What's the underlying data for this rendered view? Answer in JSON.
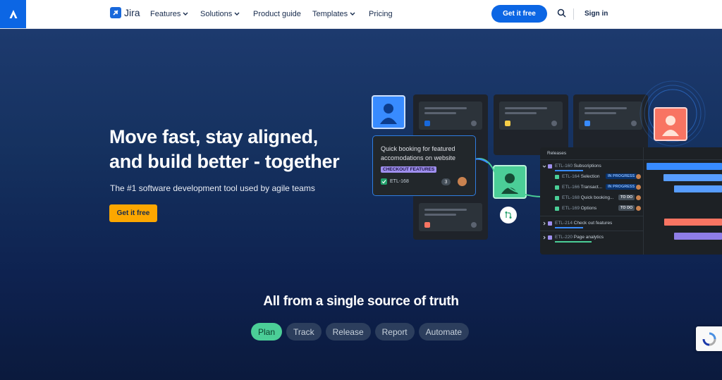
{
  "nav": {
    "brand": "Jira",
    "links": [
      "Features",
      "Solutions",
      "Product guide",
      "Templates",
      "Pricing"
    ],
    "cta": "Get it free",
    "signin": "Sign in"
  },
  "hero": {
    "headline_line1": "Move fast, stay aligned,",
    "headline_line2": "and build better - together",
    "subline": "The #1 software development tool used by agile teams",
    "cta": "Get it free"
  },
  "task_card": {
    "title": "Quick booking for featured accomodations on website",
    "tag": "CHECKOUT FEATURES",
    "id": "ETL-168",
    "count": "3"
  },
  "releases": {
    "header": "Releases",
    "rows": [
      {
        "id": "ETL-160",
        "label": "Subscriptions"
      },
      {
        "id": "ETL-164",
        "label": "Selection",
        "badge": "IN PROGRESS"
      },
      {
        "id": "ETL-166",
        "label": "Transact...",
        "badge": "IN PROGRESS"
      },
      {
        "id": "ETL-168",
        "label": "Quick booking...",
        "badge": "TO DO"
      },
      {
        "id": "ETL-169",
        "label": "Options",
        "badge": "TO DO"
      },
      {
        "id": "ETL-214",
        "label": "Check out features"
      },
      {
        "id": "ETL-220",
        "label": "Page analytics"
      }
    ]
  },
  "section": {
    "title": "All from a single source of truth",
    "tabs": [
      "Plan",
      "Track",
      "Release",
      "Report",
      "Automate"
    ],
    "active_tab": "Plan"
  },
  "colors": {
    "brand_blue": "#0c66e4",
    "cta_yellow": "#fca700",
    "tab_active": "#4bce97",
    "tab_inactive": "#2c3e5d"
  }
}
